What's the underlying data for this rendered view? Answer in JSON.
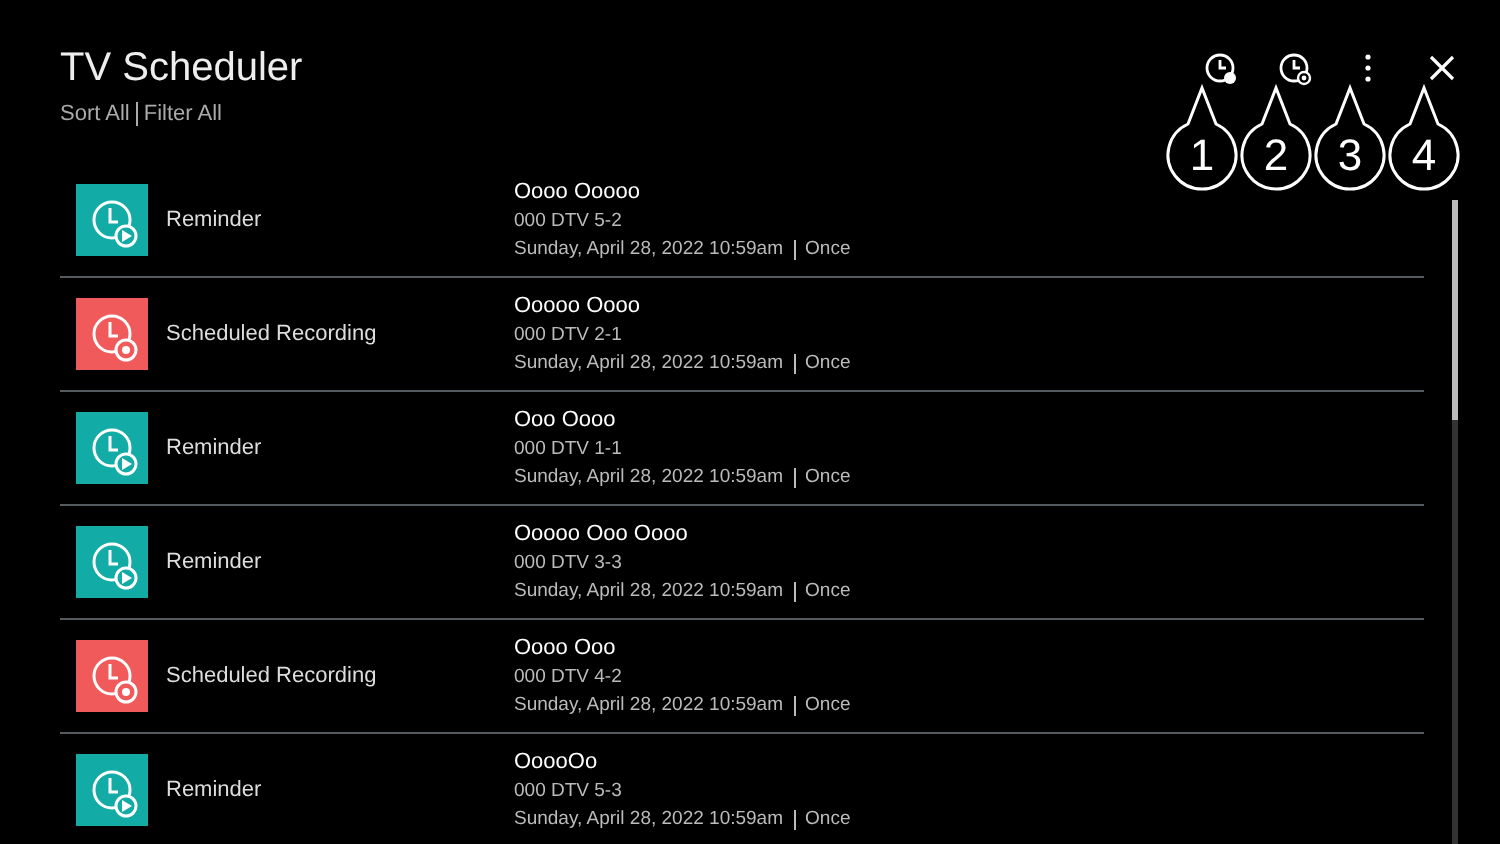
{
  "header": {
    "title": "TV Scheduler",
    "sort": "Sort All",
    "filter": "Filter All"
  },
  "toolbar": [
    {
      "kind": "reminder-add"
    },
    {
      "kind": "recording-add"
    },
    {
      "kind": "more"
    },
    {
      "kind": "close"
    }
  ],
  "callouts": [
    "1",
    "2",
    "3",
    "4"
  ],
  "schedules": [
    {
      "kind": "reminder",
      "color": "#12aba6",
      "type": "Reminder",
      "program": "Oooo Ooooo",
      "channel": "000 DTV 5-2",
      "datetime": "Sunday, April 28, 2022 10:59am",
      "repeat": "Once"
    },
    {
      "kind": "recording",
      "color": "#f05a5a",
      "type": "Scheduled Recording",
      "program": "Ooooo Oooo",
      "channel": "000 DTV 2-1",
      "datetime": "Sunday, April 28, 2022 10:59am",
      "repeat": "Once"
    },
    {
      "kind": "reminder",
      "color": "#12aba6",
      "type": "Reminder",
      "program": "Ooo Oooo",
      "channel": "000 DTV 1-1",
      "datetime": "Sunday, April 28, 2022 10:59am",
      "repeat": "Once"
    },
    {
      "kind": "reminder",
      "color": "#12aba6",
      "type": "Reminder",
      "program": "Ooooo Ooo Oooo",
      "channel": "000 DTV 3-3",
      "datetime": "Sunday, April 28, 2022 10:59am",
      "repeat": "Once"
    },
    {
      "kind": "recording",
      "color": "#f05a5a",
      "type": "Scheduled Recording",
      "program": "Oooo Ooo",
      "channel": "000 DTV 4-2",
      "datetime": "Sunday, April 28, 2022 10:59am",
      "repeat": "Once"
    },
    {
      "kind": "reminder",
      "color": "#12aba6",
      "type": "Reminder",
      "program": "OoooOo",
      "channel": "000 DTV 5-3",
      "datetime": "Sunday, April 28, 2022 10:59am",
      "repeat": "Once"
    }
  ]
}
